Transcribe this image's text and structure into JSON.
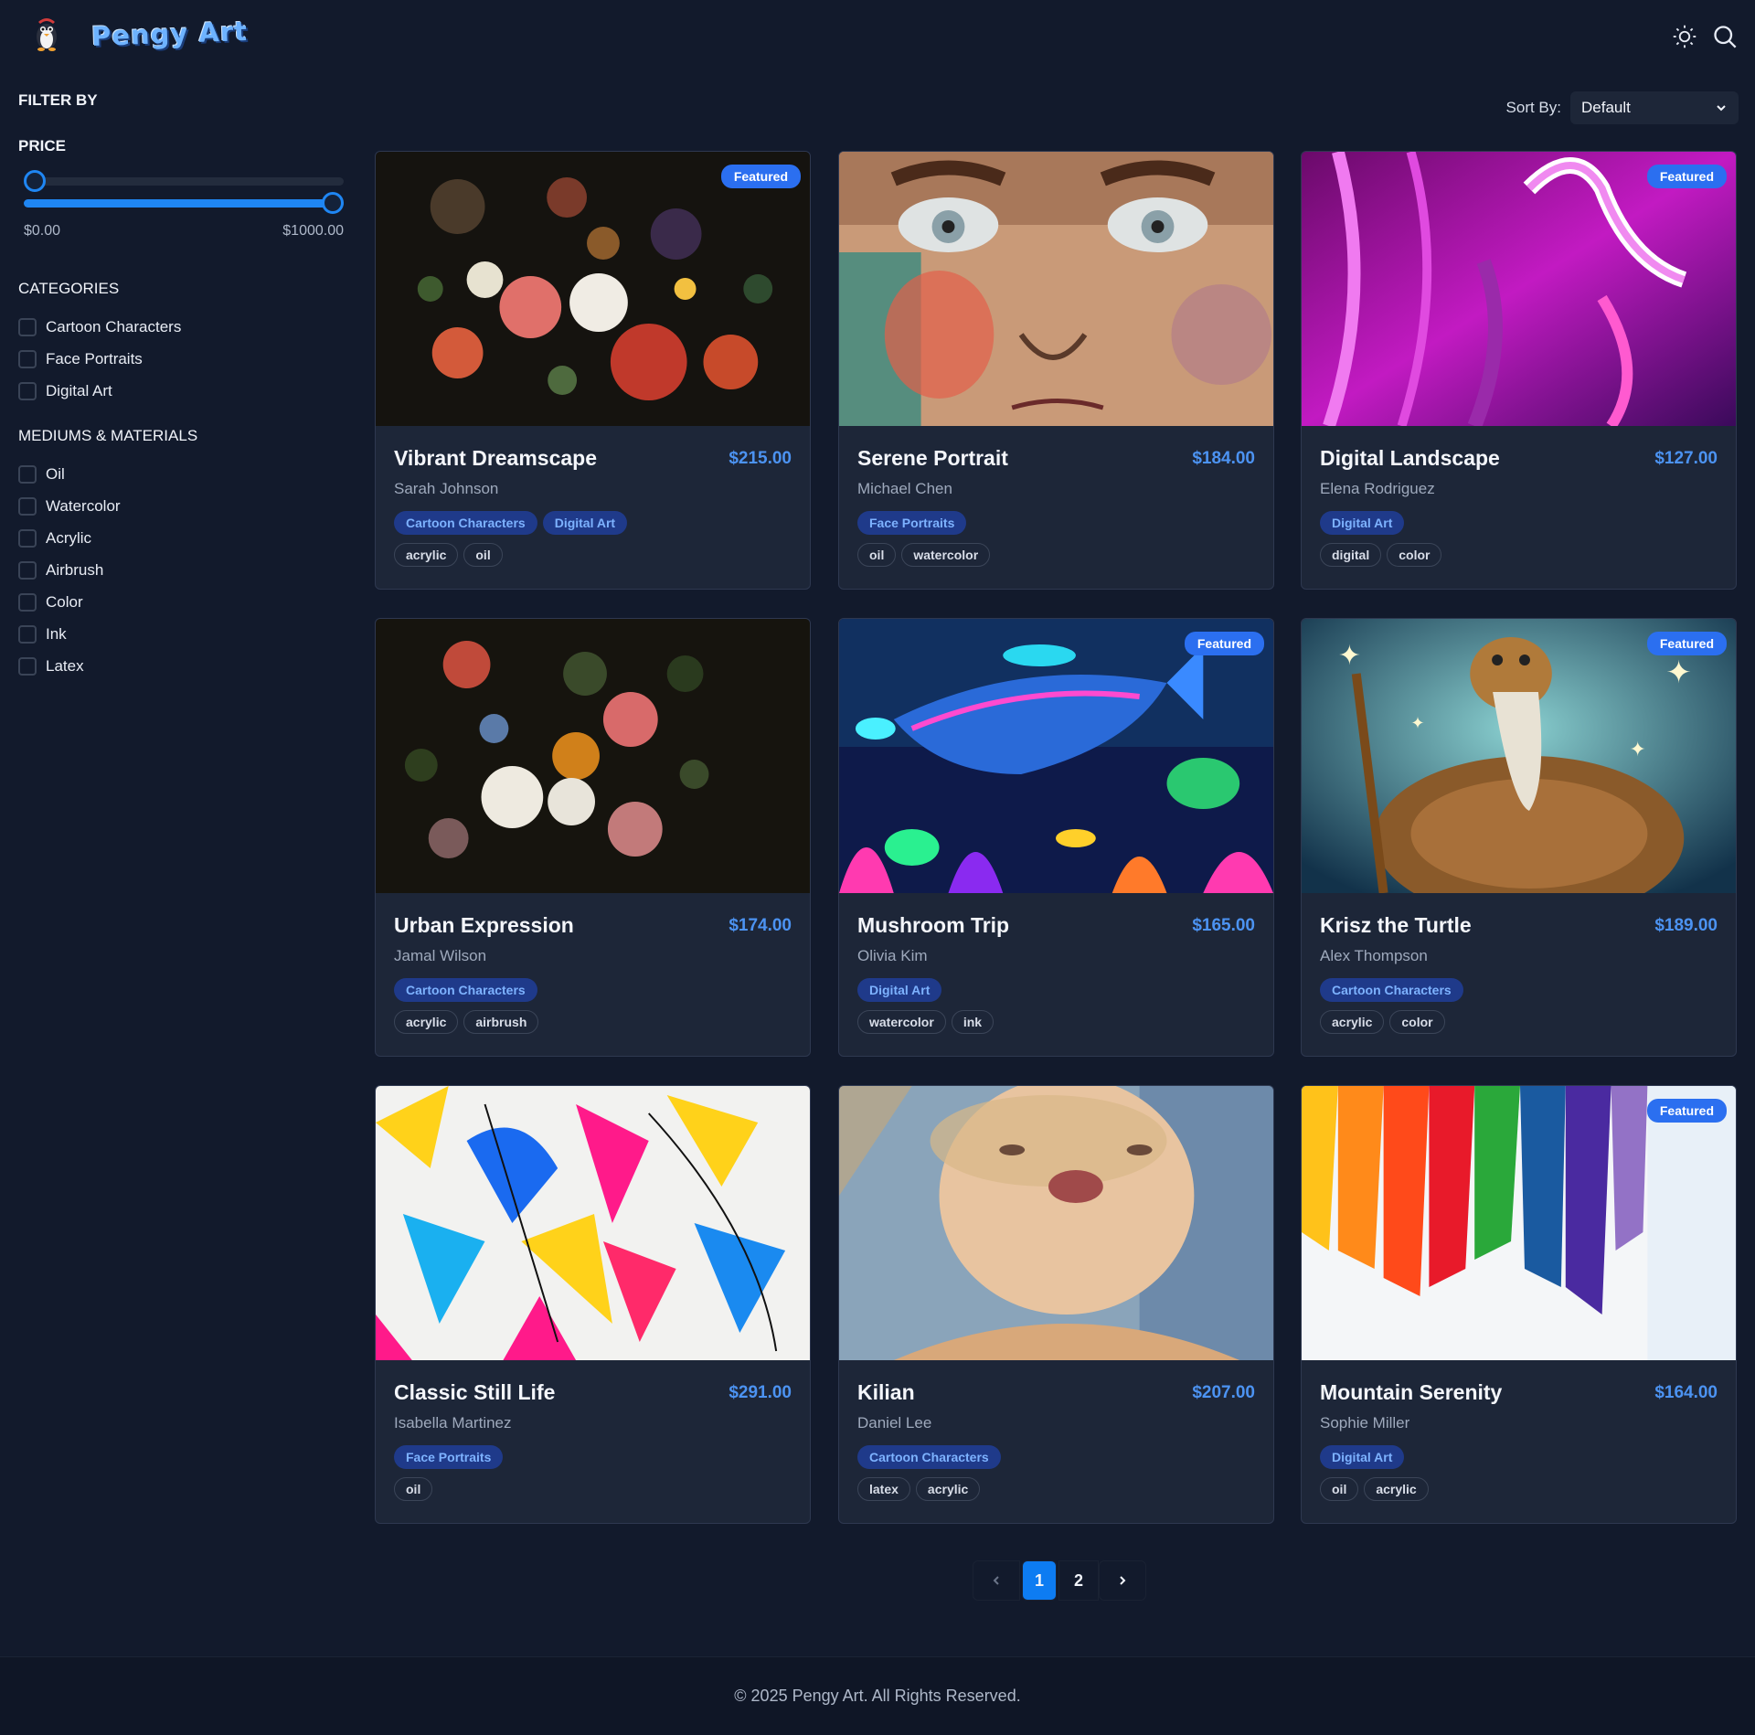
{
  "header": {
    "brand": "Pengy Art",
    "mascot_text": "Pengy",
    "theme_icon": "sun-icon",
    "search_icon": "search-icon"
  },
  "sidebar": {
    "filter_title": "FILTER BY",
    "price": {
      "title": "PRICE",
      "min_label": "$0.00",
      "max_label": "$1000.00",
      "min_value": 0,
      "max_value": 1000
    },
    "categories": {
      "title": "CATEGORIES",
      "items": [
        "Cartoon Characters",
        "Face Portraits",
        "Digital Art"
      ]
    },
    "mediums": {
      "title": "MEDIUMS & MATERIALS",
      "items": [
        "Oil",
        "Watercolor",
        "Acrylic",
        "Airbrush",
        "Color",
        "Ink",
        "Latex"
      ]
    }
  },
  "sort": {
    "label": "Sort By:",
    "selected": "Default"
  },
  "badge_label": "Featured",
  "products": [
    {
      "title": "Vibrant Dreamscape",
      "artist": "Sarah Johnson",
      "price": "$215.00",
      "featured": true,
      "categories": [
        "Cartoon Characters",
        "Digital Art"
      ],
      "mediums": [
        "acrylic",
        "oil"
      ]
    },
    {
      "title": "Serene Portrait",
      "artist": "Michael Chen",
      "price": "$184.00",
      "featured": false,
      "categories": [
        "Face Portraits"
      ],
      "mediums": [
        "oil",
        "watercolor"
      ]
    },
    {
      "title": "Digital Landscape",
      "artist": "Elena Rodriguez",
      "price": "$127.00",
      "featured": true,
      "categories": [
        "Digital Art"
      ],
      "mediums": [
        "digital",
        "color"
      ]
    },
    {
      "title": "Urban Expression",
      "artist": "Jamal Wilson",
      "price": "$174.00",
      "featured": false,
      "categories": [
        "Cartoon Characters"
      ],
      "mediums": [
        "acrylic",
        "airbrush"
      ]
    },
    {
      "title": "Mushroom Trip",
      "artist": "Olivia Kim",
      "price": "$165.00",
      "featured": true,
      "categories": [
        "Digital Art"
      ],
      "mediums": [
        "watercolor",
        "ink"
      ]
    },
    {
      "title": "Krisz the Turtle",
      "artist": "Alex Thompson",
      "price": "$189.00",
      "featured": true,
      "categories": [
        "Cartoon Characters"
      ],
      "mediums": [
        "acrylic",
        "color"
      ]
    },
    {
      "title": "Classic Still Life",
      "artist": "Isabella Martinez",
      "price": "$291.00",
      "featured": false,
      "categories": [
        "Face Portraits"
      ],
      "mediums": [
        "oil"
      ]
    },
    {
      "title": "Kilian",
      "artist": "Daniel Lee",
      "price": "$207.00",
      "featured": false,
      "categories": [
        "Cartoon Characters"
      ],
      "mediums": [
        "latex",
        "acrylic"
      ]
    },
    {
      "title": "Mountain Serenity",
      "artist": "Sophie Miller",
      "price": "$164.00",
      "featured": true,
      "categories": [
        "Digital Art"
      ],
      "mediums": [
        "oil",
        "acrylic"
      ]
    }
  ],
  "pagination": {
    "pages": [
      "1",
      "2"
    ],
    "current": "1"
  },
  "footer": {
    "text": "© 2025 Pengy Art. All Rights Reserved."
  },
  "colors": {
    "background": "#121a2c",
    "card": "#1d2638",
    "accent": "#1f86f3",
    "price": "#4c93f2",
    "category_tag": "#1f3a8a"
  }
}
